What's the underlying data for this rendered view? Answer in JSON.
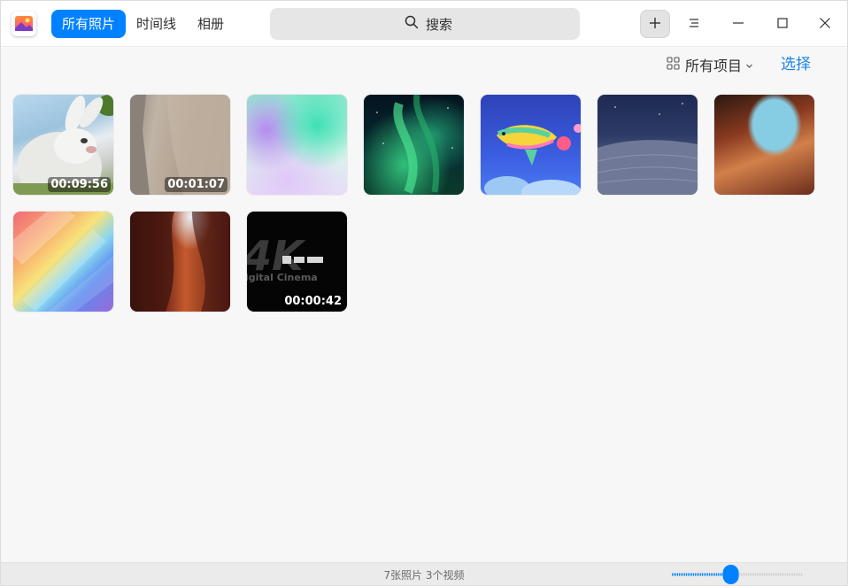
{
  "app": {
    "icon": "photos-app-icon"
  },
  "nav": {
    "tabs": [
      {
        "label": "所有照片",
        "active": true
      },
      {
        "label": "时间线",
        "active": false
      },
      {
        "label": "相册",
        "active": false
      }
    ]
  },
  "search": {
    "label": "搜索",
    "icon": "search-icon"
  },
  "titlebar_buttons": {
    "add": "plus-icon",
    "menu": "menu-icon",
    "minimize": "minimize-icon",
    "maximize": "maximize-icon",
    "close": "close-icon"
  },
  "toolbar": {
    "filter_label": "所有项目",
    "filter_icon": "grid-icon",
    "select_label": "选择"
  },
  "items": [
    {
      "kind": "video",
      "duration": "00:09:56"
    },
    {
      "kind": "video",
      "duration": "00:01:07"
    },
    {
      "kind": "photo"
    },
    {
      "kind": "photo"
    },
    {
      "kind": "photo"
    },
    {
      "kind": "photo"
    },
    {
      "kind": "photo"
    },
    {
      "kind": "photo"
    },
    {
      "kind": "photo"
    },
    {
      "kind": "video",
      "duration": "00:00:42",
      "overlay_text": "igital Cinema"
    }
  ],
  "status": {
    "summary": "7张照片 3个视频"
  },
  "zoom": {
    "level": 0.45
  },
  "colors": {
    "accent": "#0081ff",
    "link": "#1d83e6"
  }
}
